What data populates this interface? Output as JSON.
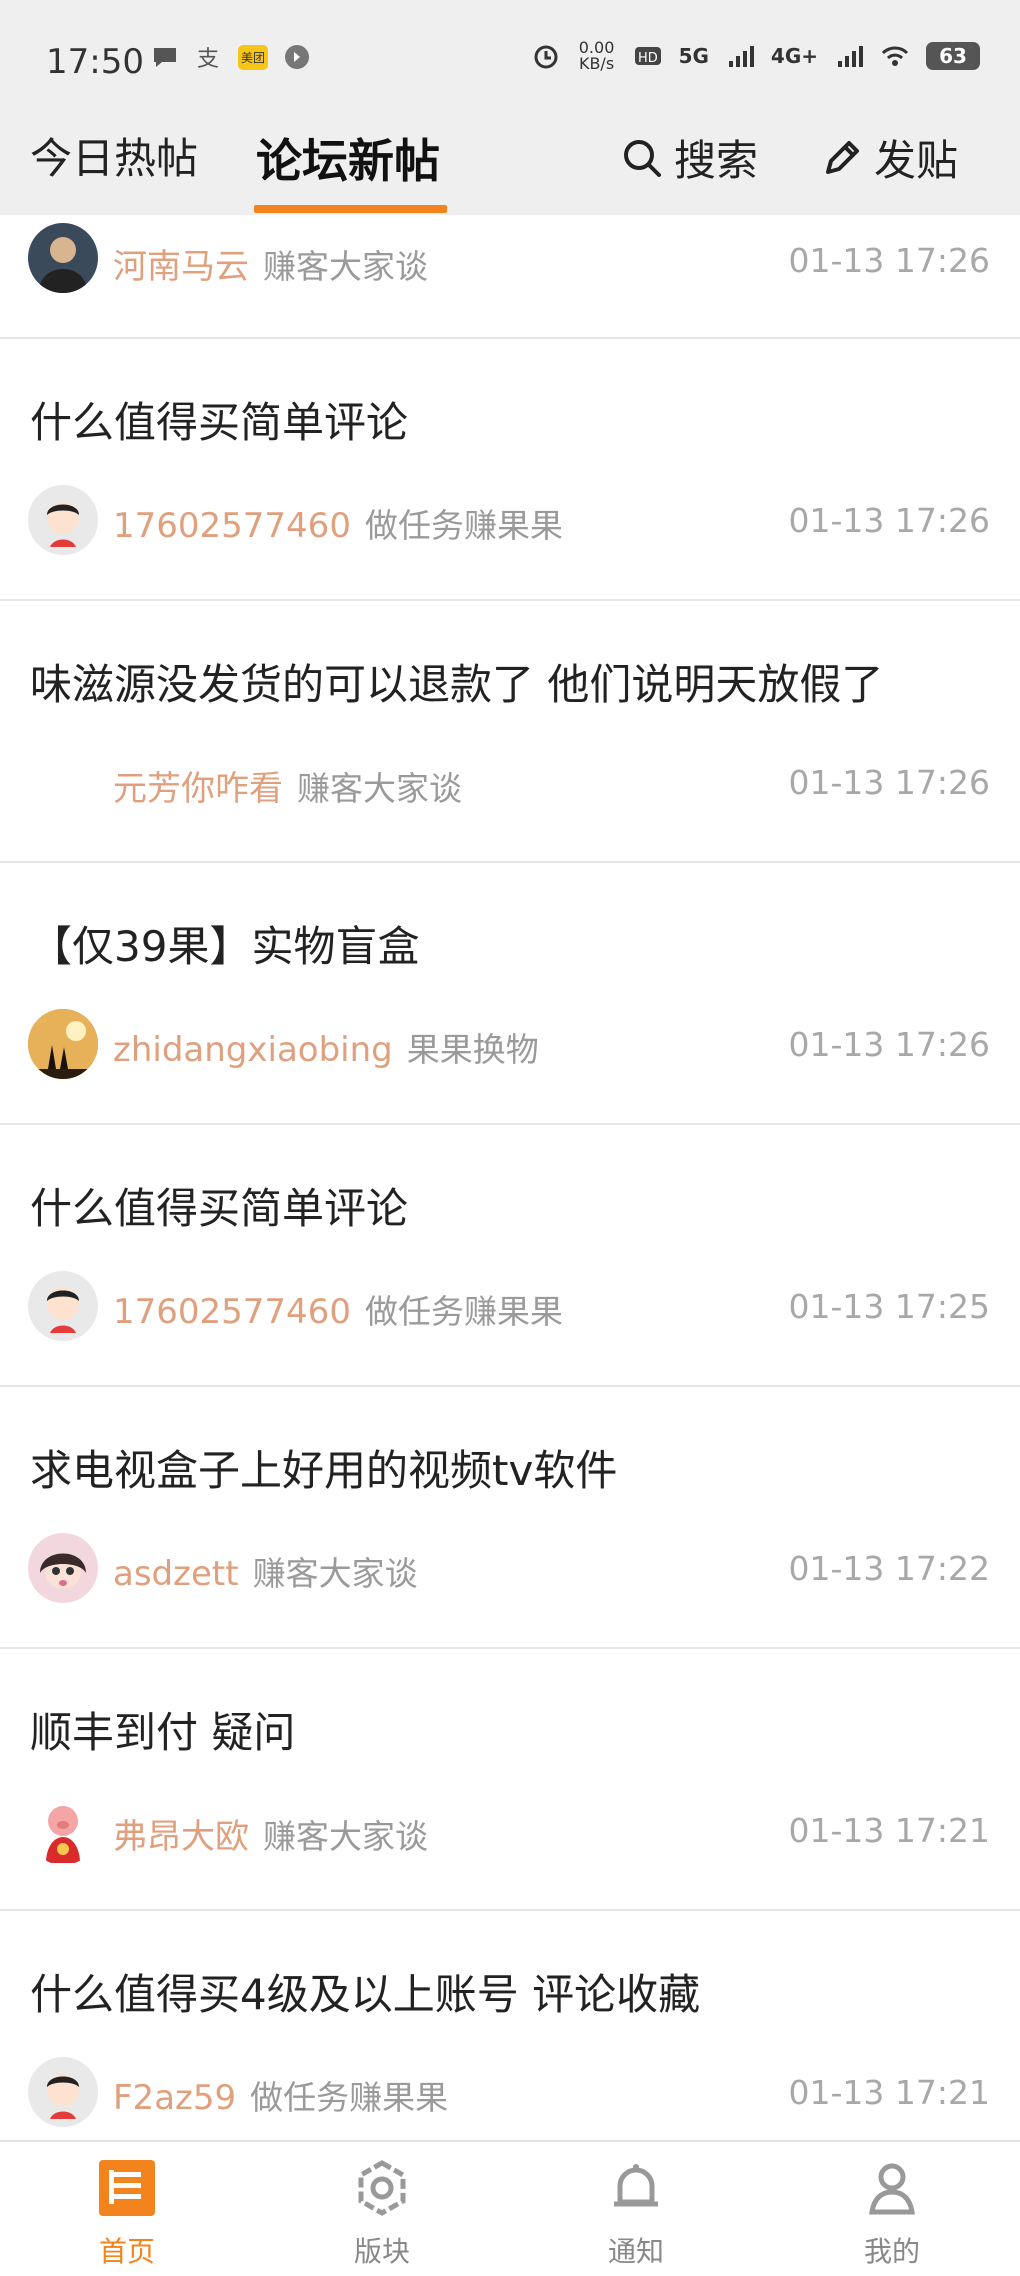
{
  "status_bar": {
    "time": "17:50",
    "network_speed": "0.00 KB/s",
    "net_5g": "5G",
    "net_4g": "4G+",
    "battery": "63",
    "app_badge": "美团"
  },
  "header": {
    "tab_today": "今日热帖",
    "tab_new": "论坛新帖",
    "search_label": "搜索",
    "post_label": "发贴",
    "accent_color": "#f2831d"
  },
  "posts": [
    {
      "title": "",
      "user": "河南马云",
      "forum": "赚客大家谈",
      "time": "01-13 17:26"
    },
    {
      "title": "什么值得买简单评论",
      "user": "17602577460",
      "forum": "做任务赚果果",
      "time": "01-13 17:26"
    },
    {
      "title": "味滋源没发货的可以退款了 他们说明天放假了",
      "user": "元芳你咋看",
      "forum": "赚客大家谈",
      "time": "01-13 17:26"
    },
    {
      "title": "【仅39果】实物盲盒",
      "user": "zhidangxiaobing",
      "forum": "果果换物",
      "time": "01-13 17:26"
    },
    {
      "title": "什么值得买简单评论",
      "user": "17602577460",
      "forum": "做任务赚果果",
      "time": "01-13 17:25"
    },
    {
      "title": "求电视盒子上好用的视频tv软件",
      "user": "asdzett",
      "forum": "赚客大家谈",
      "time": "01-13 17:22"
    },
    {
      "title": "顺丰到付 疑问",
      "user": "弗昂大欧",
      "forum": "赚客大家谈",
      "time": "01-13 17:21"
    },
    {
      "title": "什么值得买4级及以上账号 评论收藏",
      "user": "F2az59",
      "forum": "做任务赚果果",
      "time": "01-13 17:21"
    }
  ],
  "tabbar": {
    "home": "首页",
    "sections": "版块",
    "notify": "通知",
    "mine": "我的"
  }
}
